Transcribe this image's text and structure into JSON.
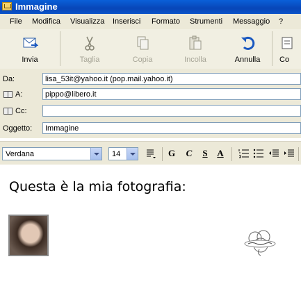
{
  "window": {
    "title": "Immagine"
  },
  "menu": [
    "File",
    "Modifica",
    "Visualizza",
    "Inserisci",
    "Formato",
    "Strumenti",
    "Messaggio",
    "?"
  ],
  "toolbar": {
    "send": "Invia",
    "cut": "Taglia",
    "copy": "Copia",
    "paste": "Incolla",
    "undo": "Annulla",
    "check": "Co"
  },
  "headers": {
    "from_label": "Da:",
    "from_value": "lisa_53it@yahoo.it    (pop.mail.yahoo.it)",
    "to_label": "A:",
    "to_value": "pippo@libero.it",
    "cc_label": "Cc:",
    "cc_value": "",
    "subject_label": "Oggetto:",
    "subject_value": "Immagine"
  },
  "format": {
    "font": "Verdana",
    "size": "14",
    "bold": "G",
    "italic": "C",
    "underline": "S",
    "color": "A"
  },
  "message": {
    "text": "Questa è la mia fotografia:"
  },
  "colors": {
    "title_bar": "#0a53c9",
    "toolbar_bg": "#f1efe2",
    "accent_blue": "#1a58c0"
  }
}
